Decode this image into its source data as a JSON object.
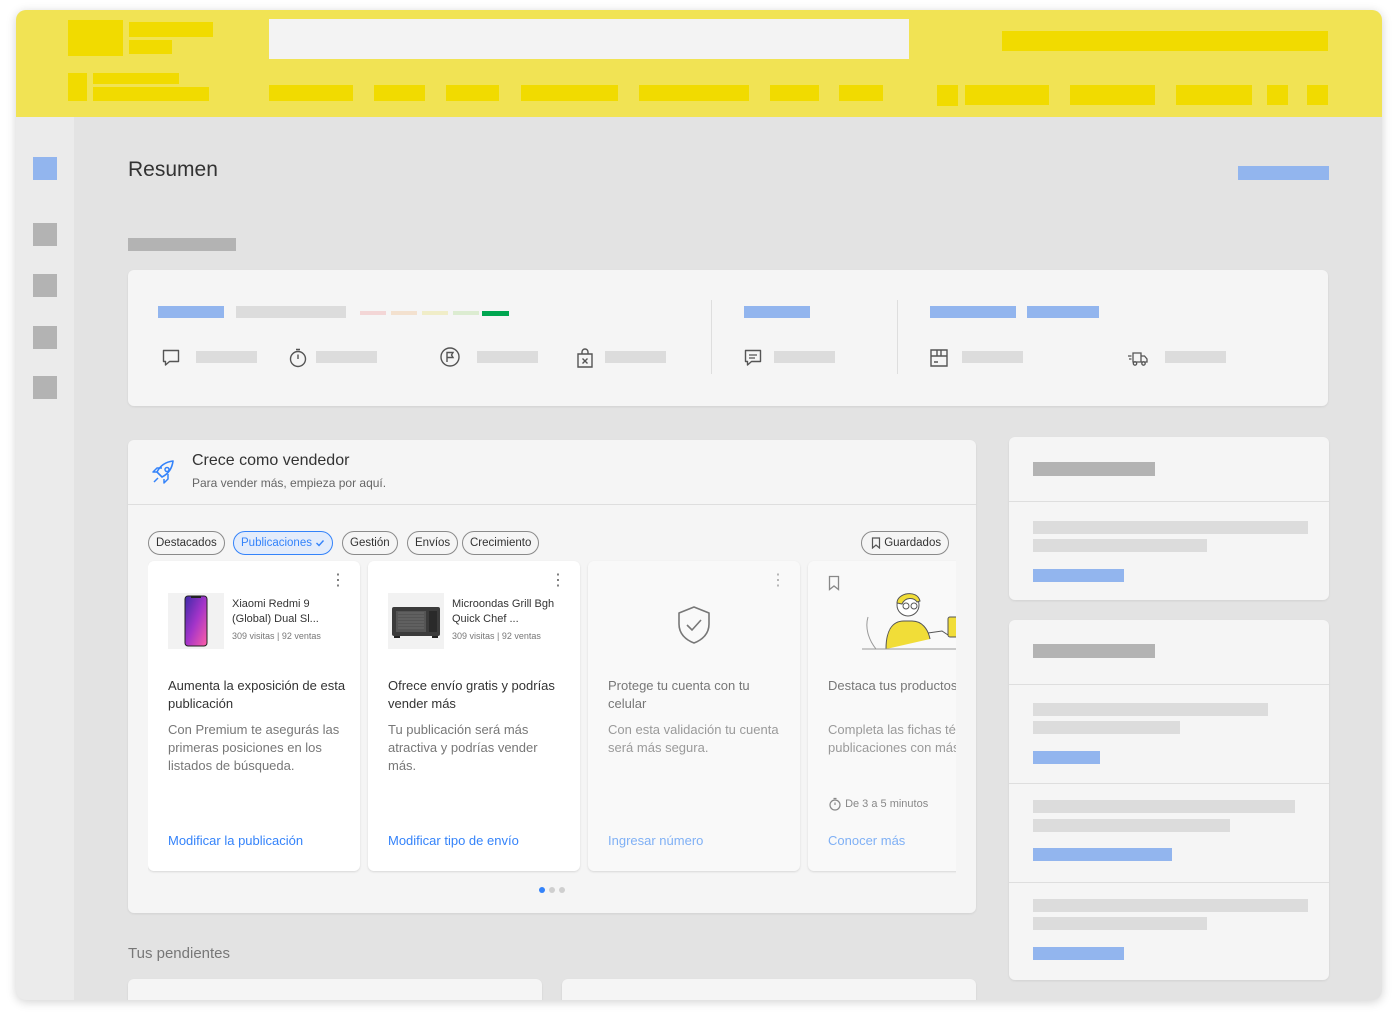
{
  "page": {
    "title": "Resumen",
    "pending_title": "Tus pendientes"
  },
  "grow": {
    "title": "Crece como vendedor",
    "subtitle": "Para vender más, empieza por aquí.",
    "chips": [
      {
        "label": "Destacados",
        "selected": false
      },
      {
        "label": "Publicaciones",
        "selected": true
      },
      {
        "label": "Gestión",
        "selected": false
      },
      {
        "label": "Envíos",
        "selected": false
      },
      {
        "label": "Crecimiento",
        "selected": false
      }
    ],
    "saved_label": "Guardados",
    "cards": [
      {
        "product_name": "Xiaomi Redmi 9 (Global) Dual Sl...",
        "product_meta": "309 visitas | 92 ventas",
        "heading": "Aumenta la exposición de esta publicación",
        "description": "Con Premium te asegurás las primeras posiciones en los listados de búsqueda.",
        "link": "Modificar la publicación"
      },
      {
        "product_name": "Microondas Grill Bgh Quick Chef ...",
        "product_meta": "309 visitas | 92 ventas",
        "heading": "Ofrece envío gratis y podrías vender más",
        "description": "Tu publicación será más atractiva y podrías vender más.",
        "link": "Modificar tipo de envío"
      },
      {
        "heading": "Protege tu cuenta con tu celular",
        "description": "Con esta validación tu cuenta será más segura.",
        "link": "Ingresar número"
      },
      {
        "heading": "Destaca tus productos exitosos",
        "description": "Completa las fichas técnicas de publicaciones con más ventas.",
        "time": "De 3 a 5 minutos",
        "link": "Conocer más"
      }
    ],
    "pagination": {
      "current": 1,
      "total": 3
    }
  },
  "colors": {
    "header_yellow": "#f1e354",
    "accent_blue": "#3483fa",
    "placeholder_blue": "#92b5ee",
    "reputation_green": "#00a650"
  }
}
